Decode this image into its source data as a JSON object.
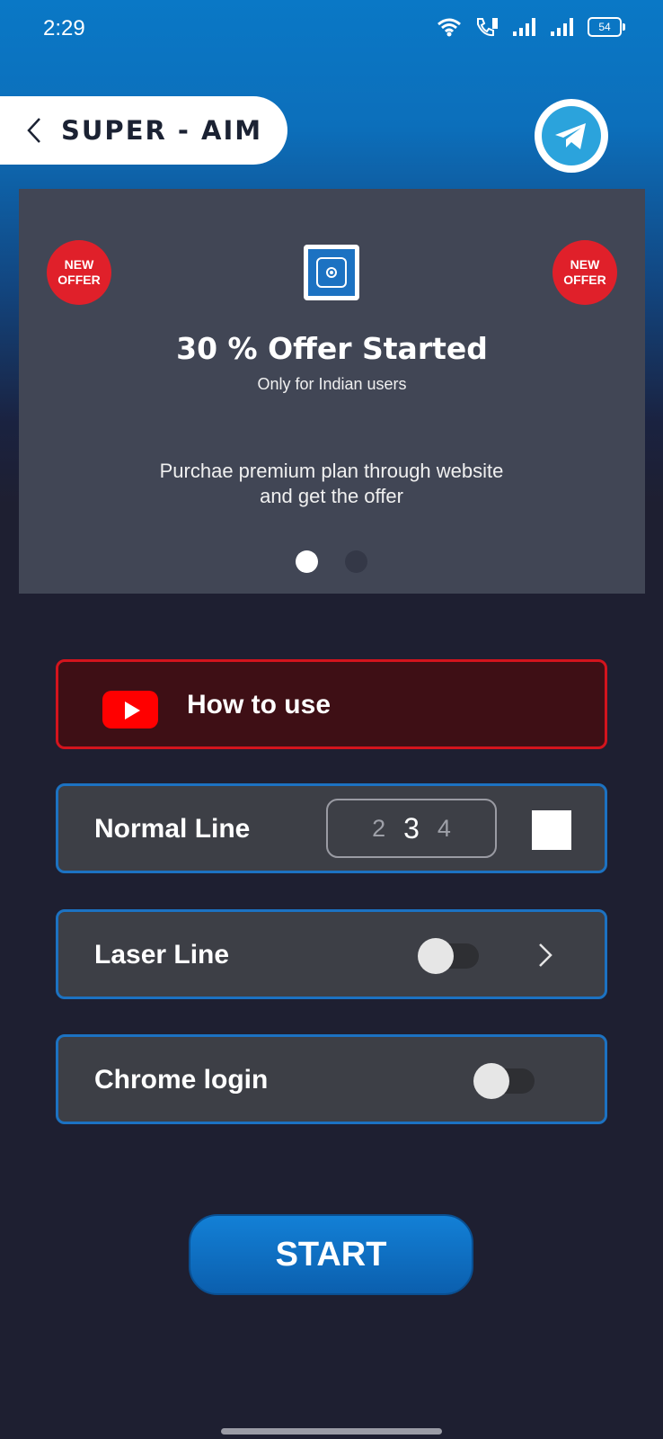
{
  "status_bar": {
    "time": "2:29",
    "battery": "54"
  },
  "header": {
    "title": "SUPER - AIM"
  },
  "banner": {
    "badge_left": [
      "NEW",
      "OFFER"
    ],
    "badge_right": [
      "NEW",
      "OFFER"
    ],
    "title": "30 % Offer Started",
    "subtitle": "Only for Indian users",
    "description": "Purchae premium plan through website and get the offer",
    "active_slide": 1,
    "slide_count": 2
  },
  "howto": {
    "label": "How to use"
  },
  "normal_line": {
    "label": "Normal Line",
    "picker": {
      "prev": "2",
      "selected": "3",
      "next": "4"
    },
    "color": "#ffffff"
  },
  "laser_line": {
    "label": "Laser Line",
    "enabled": false
  },
  "chrome_login": {
    "label": "Chrome login",
    "enabled": false
  },
  "start_button": {
    "label": "START"
  },
  "colors": {
    "accent": "#1c72c2",
    "youtube": "#ff0000",
    "badge": "#e0202a"
  }
}
